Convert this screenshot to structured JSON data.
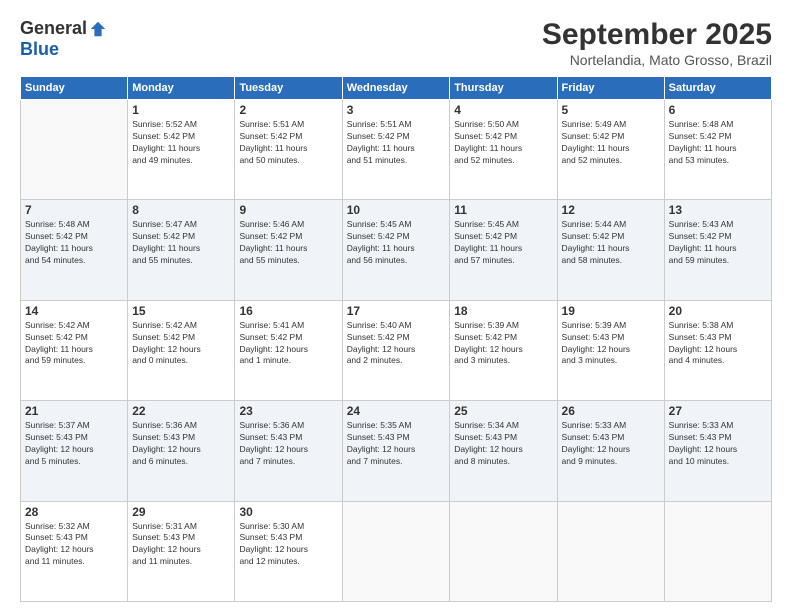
{
  "logo": {
    "general": "General",
    "blue": "Blue"
  },
  "title": "September 2025",
  "location": "Nortelandia, Mato Grosso, Brazil",
  "days_of_week": [
    "Sunday",
    "Monday",
    "Tuesday",
    "Wednesday",
    "Thursday",
    "Friday",
    "Saturday"
  ],
  "weeks": [
    [
      {
        "day": "",
        "info": ""
      },
      {
        "day": "1",
        "info": "Sunrise: 5:52 AM\nSunset: 5:42 PM\nDaylight: 11 hours\nand 49 minutes."
      },
      {
        "day": "2",
        "info": "Sunrise: 5:51 AM\nSunset: 5:42 PM\nDaylight: 11 hours\nand 50 minutes."
      },
      {
        "day": "3",
        "info": "Sunrise: 5:51 AM\nSunset: 5:42 PM\nDaylight: 11 hours\nand 51 minutes."
      },
      {
        "day": "4",
        "info": "Sunrise: 5:50 AM\nSunset: 5:42 PM\nDaylight: 11 hours\nand 52 minutes."
      },
      {
        "day": "5",
        "info": "Sunrise: 5:49 AM\nSunset: 5:42 PM\nDaylight: 11 hours\nand 52 minutes."
      },
      {
        "day": "6",
        "info": "Sunrise: 5:48 AM\nSunset: 5:42 PM\nDaylight: 11 hours\nand 53 minutes."
      }
    ],
    [
      {
        "day": "7",
        "info": "Sunrise: 5:48 AM\nSunset: 5:42 PM\nDaylight: 11 hours\nand 54 minutes."
      },
      {
        "day": "8",
        "info": "Sunrise: 5:47 AM\nSunset: 5:42 PM\nDaylight: 11 hours\nand 55 minutes."
      },
      {
        "day": "9",
        "info": "Sunrise: 5:46 AM\nSunset: 5:42 PM\nDaylight: 11 hours\nand 55 minutes."
      },
      {
        "day": "10",
        "info": "Sunrise: 5:45 AM\nSunset: 5:42 PM\nDaylight: 11 hours\nand 56 minutes."
      },
      {
        "day": "11",
        "info": "Sunrise: 5:45 AM\nSunset: 5:42 PM\nDaylight: 11 hours\nand 57 minutes."
      },
      {
        "day": "12",
        "info": "Sunrise: 5:44 AM\nSunset: 5:42 PM\nDaylight: 11 hours\nand 58 minutes."
      },
      {
        "day": "13",
        "info": "Sunrise: 5:43 AM\nSunset: 5:42 PM\nDaylight: 11 hours\nand 59 minutes."
      }
    ],
    [
      {
        "day": "14",
        "info": "Sunrise: 5:42 AM\nSunset: 5:42 PM\nDaylight: 11 hours\nand 59 minutes."
      },
      {
        "day": "15",
        "info": "Sunrise: 5:42 AM\nSunset: 5:42 PM\nDaylight: 12 hours\nand 0 minutes."
      },
      {
        "day": "16",
        "info": "Sunrise: 5:41 AM\nSunset: 5:42 PM\nDaylight: 12 hours\nand 1 minute."
      },
      {
        "day": "17",
        "info": "Sunrise: 5:40 AM\nSunset: 5:42 PM\nDaylight: 12 hours\nand 2 minutes."
      },
      {
        "day": "18",
        "info": "Sunrise: 5:39 AM\nSunset: 5:42 PM\nDaylight: 12 hours\nand 3 minutes."
      },
      {
        "day": "19",
        "info": "Sunrise: 5:39 AM\nSunset: 5:43 PM\nDaylight: 12 hours\nand 3 minutes."
      },
      {
        "day": "20",
        "info": "Sunrise: 5:38 AM\nSunset: 5:43 PM\nDaylight: 12 hours\nand 4 minutes."
      }
    ],
    [
      {
        "day": "21",
        "info": "Sunrise: 5:37 AM\nSunset: 5:43 PM\nDaylight: 12 hours\nand 5 minutes."
      },
      {
        "day": "22",
        "info": "Sunrise: 5:36 AM\nSunset: 5:43 PM\nDaylight: 12 hours\nand 6 minutes."
      },
      {
        "day": "23",
        "info": "Sunrise: 5:36 AM\nSunset: 5:43 PM\nDaylight: 12 hours\nand 7 minutes."
      },
      {
        "day": "24",
        "info": "Sunrise: 5:35 AM\nSunset: 5:43 PM\nDaylight: 12 hours\nand 7 minutes."
      },
      {
        "day": "25",
        "info": "Sunrise: 5:34 AM\nSunset: 5:43 PM\nDaylight: 12 hours\nand 8 minutes."
      },
      {
        "day": "26",
        "info": "Sunrise: 5:33 AM\nSunset: 5:43 PM\nDaylight: 12 hours\nand 9 minutes."
      },
      {
        "day": "27",
        "info": "Sunrise: 5:33 AM\nSunset: 5:43 PM\nDaylight: 12 hours\nand 10 minutes."
      }
    ],
    [
      {
        "day": "28",
        "info": "Sunrise: 5:32 AM\nSunset: 5:43 PM\nDaylight: 12 hours\nand 11 minutes."
      },
      {
        "day": "29",
        "info": "Sunrise: 5:31 AM\nSunset: 5:43 PM\nDaylight: 12 hours\nand 11 minutes."
      },
      {
        "day": "30",
        "info": "Sunrise: 5:30 AM\nSunset: 5:43 PM\nDaylight: 12 hours\nand 12 minutes."
      },
      {
        "day": "",
        "info": ""
      },
      {
        "day": "",
        "info": ""
      },
      {
        "day": "",
        "info": ""
      },
      {
        "day": "",
        "info": ""
      }
    ]
  ]
}
